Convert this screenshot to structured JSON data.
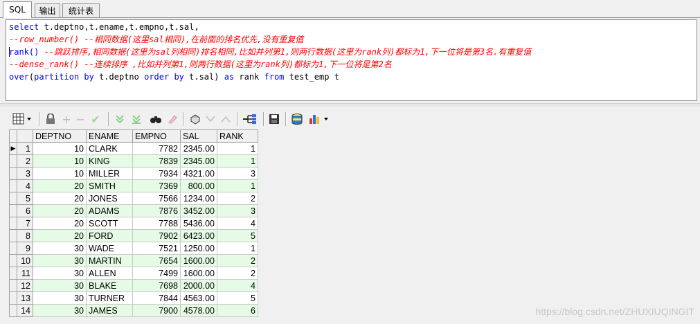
{
  "tabs": [
    {
      "label": "SQL",
      "active": true
    },
    {
      "label": "输出",
      "active": false
    },
    {
      "label": "统计表",
      "active": false
    }
  ],
  "editor": {
    "line1": {
      "kw": "select",
      "rest": " t.deptno,t.ename,t.empno,t.sal,"
    },
    "line2": {
      "fn": "--row_number()",
      "comment": " --相同数据(这里sal相同),在前面的排名优先,没有重复值"
    },
    "line3": {
      "fn": "rank()",
      "comment": " --跳跃排序,相同数据(这里为sal列相同)排名相同,比如并列第1,则两行数据(这里为rank列)都标为1,下一位将是第3名.有重复值"
    },
    "line4": {
      "fn": "--dense_rank()",
      "comment": " --连续排序 ,比如并列第1,则两行数据(这里为rank列)都标为1,下一位将是第2名"
    },
    "line5": {
      "over": "over",
      "paren": "(",
      "partition": "partition by",
      "col1": " t.deptno ",
      "order": "order by",
      "col2": " t.sal) ",
      "as": "as",
      "alias": " rank ",
      "from": "from",
      "table": " test_emp t"
    }
  },
  "toolbar": {
    "icons": [
      "grid-menu-icon",
      "lock-icon",
      "add-record-icon",
      "delete-record-icon",
      "post-record-icon",
      "filter-down-icon",
      "filter-all-icon",
      "find-icon",
      "clear-icon",
      "print-icon",
      "nav-down-icon",
      "nav-up-icon",
      "query-tree-icon",
      "save-icon",
      "export-db-icon",
      "chart-icon"
    ]
  },
  "grid": {
    "columns": [
      "DEPTNO",
      "ENAME",
      "EMPNO",
      "SAL",
      "RANK"
    ],
    "rows": [
      {
        "n": "1",
        "deptno": "10",
        "ename": "CLARK",
        "empno": "7782",
        "sal": "2345.00",
        "rank": "1"
      },
      {
        "n": "2",
        "deptno": "10",
        "ename": "KING",
        "empno": "7839",
        "sal": "2345.00",
        "rank": "1"
      },
      {
        "n": "3",
        "deptno": "10",
        "ename": "MILLER",
        "empno": "7934",
        "sal": "4321.00",
        "rank": "3"
      },
      {
        "n": "4",
        "deptno": "20",
        "ename": "SMITH",
        "empno": "7369",
        "sal": "800.00",
        "rank": "1"
      },
      {
        "n": "5",
        "deptno": "20",
        "ename": "JONES",
        "empno": "7566",
        "sal": "1234.00",
        "rank": "2"
      },
      {
        "n": "6",
        "deptno": "20",
        "ename": "ADAMS",
        "empno": "7876",
        "sal": "3452.00",
        "rank": "3"
      },
      {
        "n": "7",
        "deptno": "20",
        "ename": "SCOTT",
        "empno": "7788",
        "sal": "5436.00",
        "rank": "4"
      },
      {
        "n": "8",
        "deptno": "20",
        "ename": "FORD",
        "empno": "7902",
        "sal": "6423.00",
        "rank": "5"
      },
      {
        "n": "9",
        "deptno": "30",
        "ename": "WADE",
        "empno": "7521",
        "sal": "1250.00",
        "rank": "1"
      },
      {
        "n": "10",
        "deptno": "30",
        "ename": "MARTIN",
        "empno": "7654",
        "sal": "1600.00",
        "rank": "2"
      },
      {
        "n": "11",
        "deptno": "30",
        "ename": "ALLEN",
        "empno": "7499",
        "sal": "1600.00",
        "rank": "2"
      },
      {
        "n": "12",
        "deptno": "30",
        "ename": "BLAKE",
        "empno": "7698",
        "sal": "2000.00",
        "rank": "4"
      },
      {
        "n": "13",
        "deptno": "30",
        "ename": "TURNER",
        "empno": "7844",
        "sal": "4563.00",
        "rank": "5"
      },
      {
        "n": "14",
        "deptno": "30",
        "ename": "JAMES",
        "empno": "7900",
        "sal": "4578.00",
        "rank": "6"
      }
    ],
    "current_row_indicator": "▶"
  },
  "watermark": "https://blog.csdn.net/ZHUXIUQINGIT",
  "colors": {
    "keyword": "#0000ff",
    "comment": "#ff0000",
    "odd_row": "#e6fbe6"
  }
}
